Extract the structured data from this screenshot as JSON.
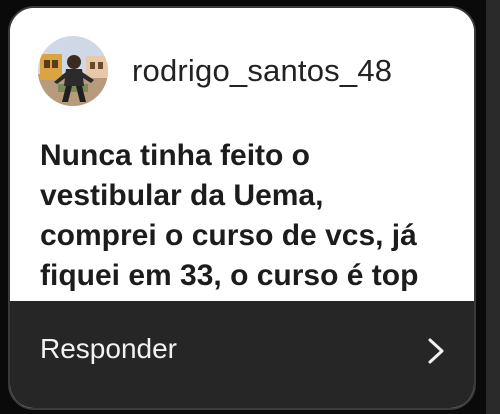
{
  "story_reply_card": {
    "username": "rodrigo_santos_48",
    "message": "Nunca tinha feito o\nvestibular da Uema,\ncomprei o curso de vcs, já\nfiquei em 33, o curso é top",
    "reply_label": "Responder",
    "avatar_icon": "profile-photo",
    "chevron_icon": "chevron-right-icon"
  },
  "colors": {
    "card_background": "#ffffff",
    "reply_bar_background": "#262626",
    "text_dark": "#1c1c1c",
    "text_light": "#f2f2f2"
  }
}
